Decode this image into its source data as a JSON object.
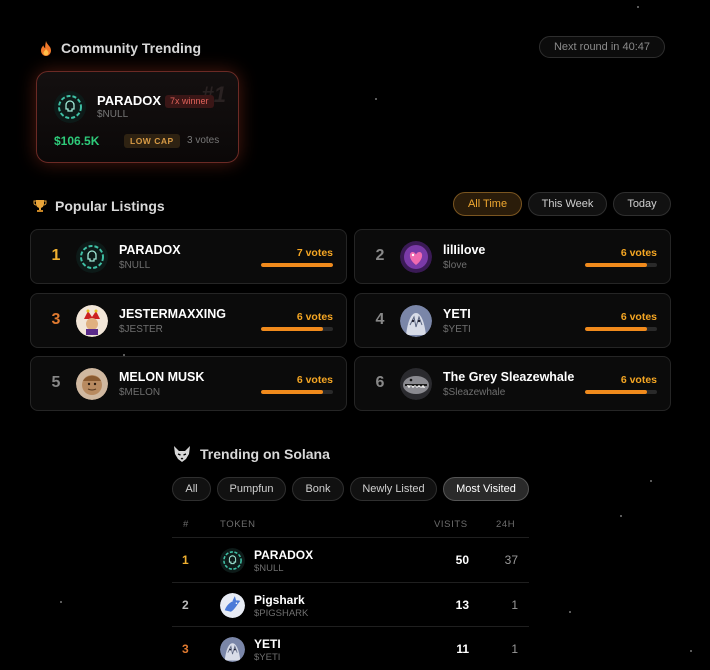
{
  "community": {
    "title": "Community Trending",
    "next_round": "Next round in 40:47",
    "card": {
      "rank_badge": "#1",
      "name": "PARADOX",
      "winner_badge": "7x winner",
      "ticker": "$NULL",
      "price": "$106.5K",
      "cap_badge": "LOW CAP",
      "votes": "3 votes"
    }
  },
  "popular": {
    "title": "Popular Listings",
    "filters": [
      "All Time",
      "This Week",
      "Today"
    ],
    "active_filter": "All Time",
    "items": [
      {
        "rank": "1",
        "name": "PARADOX",
        "ticker": "$NULL",
        "votes": "7 votes",
        "vote_fraction": 1.0,
        "avatar": "paradox-avatar"
      },
      {
        "rank": "2",
        "name": "lilIilove",
        "ticker": "$love",
        "votes": "6 votes",
        "vote_fraction": 0.86,
        "avatar": "heart-avatar"
      },
      {
        "rank": "3",
        "name": "JESTERMAXXING",
        "ticker": "$JESTER",
        "votes": "6 votes",
        "vote_fraction": 0.86,
        "avatar": "jester-avatar"
      },
      {
        "rank": "4",
        "name": "YETI",
        "ticker": "$YETI",
        "votes": "6 votes",
        "vote_fraction": 0.86,
        "avatar": "yeti-avatar"
      },
      {
        "rank": "5",
        "name": "MELON MUSK",
        "ticker": "$MELON",
        "votes": "6 votes",
        "vote_fraction": 0.86,
        "avatar": "melon-avatar"
      },
      {
        "rank": "6",
        "name": "The Grey Sleazewhale",
        "ticker": "$Sleazewhale",
        "votes": "6 votes",
        "vote_fraction": 0.86,
        "avatar": "whale-avatar"
      }
    ]
  },
  "solana": {
    "title": "Trending on Solana",
    "filters": [
      "All",
      "Pumpfun",
      "Bonk",
      "Newly Listed",
      "Most Visited"
    ],
    "active_filter": "Most Visited",
    "columns": {
      "idx": "#",
      "token": "TOKEN",
      "visits": "VISITS",
      "h24": "24H"
    },
    "rows": [
      {
        "idx": "1",
        "name": "PARADOX",
        "ticker": "$NULL",
        "visits": "50",
        "h24": "37",
        "avatar": "paradox-avatar"
      },
      {
        "idx": "2",
        "name": "Pigshark",
        "ticker": "$PIGSHARK",
        "visits": "13",
        "h24": "1",
        "avatar": "pigshark-avatar"
      },
      {
        "idx": "3",
        "name": "YETI",
        "ticker": "$YETI",
        "visits": "11",
        "h24": "1",
        "avatar": "yeti-avatar"
      }
    ]
  },
  "colors": {
    "accent_orange": "#f5a623",
    "price_green": "#2ecb7a",
    "gold_rank": "#f0b030",
    "bronze_rank": "#e07a30"
  }
}
